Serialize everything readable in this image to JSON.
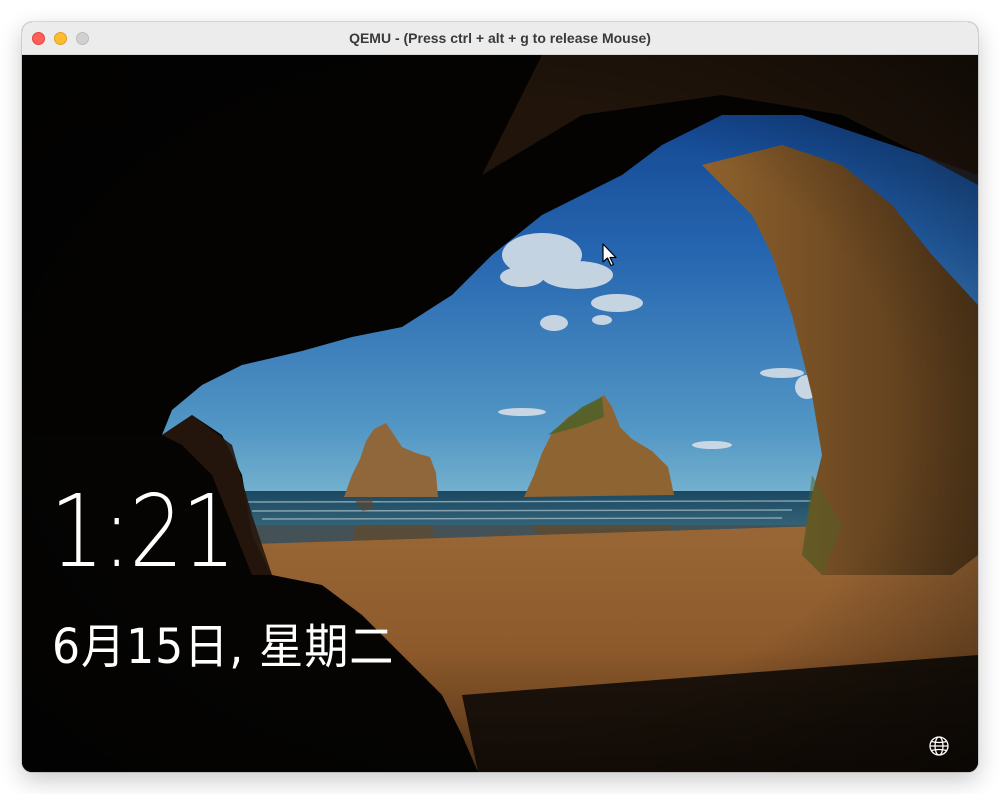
{
  "window": {
    "title": "QEMU - (Press ctrl + alt + g to release Mouse)",
    "controls": [
      "close",
      "minimize",
      "maximize"
    ]
  },
  "lockscreen": {
    "time": "1:21",
    "date": "6月15日, 星期二",
    "network_icon": "globe-icon",
    "pointer_icon": "mouse-cursor-icon"
  },
  "colors": {
    "close": "#fe5f57",
    "minimize": "#febc2e",
    "maximize": "#d0d0d0",
    "text": "#ffffff"
  }
}
